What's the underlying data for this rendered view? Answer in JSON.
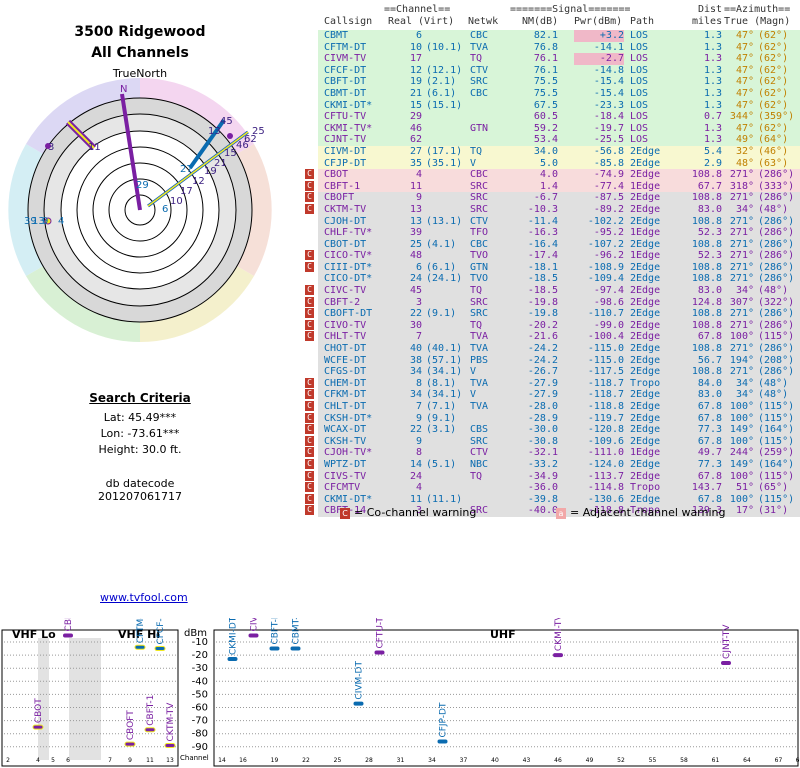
{
  "site": {
    "title_line1": "3500 Ridgewood",
    "title_line2": "All Channels",
    "true_north": "TrueNorth",
    "search_header": "Search Criteria",
    "lat": "Lat: 45.49***",
    "lon": "Lon: -73.61***",
    "height": "Height: 30.0 ft.",
    "db_label": "db datecode",
    "db_value": "201207061717",
    "link": "www.tvfool.com"
  },
  "table_headers": {
    "channel_group": "==Channel==",
    "signal_group": "=======Signal=======",
    "dist_top": "Dist",
    "azimuth_group": "==Azimuth==",
    "callsign": "Callsign",
    "real": "Real",
    "virt": "(Virt)",
    "netwk": "Netwk",
    "nm": "NM(dB)",
    "pwr": "Pwr(dBm)",
    "path": "Path",
    "miles": "miles",
    "true_magn": "True (Magn)"
  },
  "legend": {
    "co_mark": "C",
    "co_text": "= Co-channel warning",
    "adj_mark": "a",
    "adj_text": "= Adjacent channel warning"
  },
  "colors": {
    "green": "#d8f5d8",
    "yellow": "#f8f8d0",
    "red": "#f8dcdc",
    "gray": "#e0e0e0",
    "blue": "#0a6bb0",
    "purple": "#7a1fa2",
    "magenta_pwr": "#f0b8c8"
  },
  "stations": [
    {
      "call": "CBMT",
      "real": "6",
      "virt": "",
      "net": "CBC",
      "nm": "82.1",
      "pwr": "+3.2",
      "path": "LOS",
      "dist": "1.3",
      "true": "47°",
      "mag": "(62°)",
      "band": "green",
      "color": "blue",
      "warn": "",
      "hl": true
    },
    {
      "call": "CFTM-DT",
      "real": "10",
      "virt": "(10.1)",
      "net": "TVA",
      "nm": "76.8",
      "pwr": "-14.1",
      "path": "LOS",
      "dist": "1.3",
      "true": "47°",
      "mag": "(62°)",
      "band": "green",
      "color": "blue",
      "warn": ""
    },
    {
      "call": "CIVM-TV",
      "real": "17",
      "virt": "",
      "net": "TQ",
      "nm": "76.1",
      "pwr": "-2.7",
      "path": "LOS",
      "dist": "1.3",
      "true": "47°",
      "mag": "(62°)",
      "band": "green",
      "color": "purple",
      "warn": "",
      "hl": true
    },
    {
      "call": "CFCF-DT",
      "real": "12",
      "virt": "(12.1)",
      "net": "CTV",
      "nm": "76.1",
      "pwr": "-14.8",
      "path": "LOS",
      "dist": "1.3",
      "true": "47°",
      "mag": "(62°)",
      "band": "green",
      "color": "blue",
      "warn": ""
    },
    {
      "call": "CBFT-DT",
      "real": "19",
      "virt": "(2.1)",
      "net": "SRC",
      "nm": "75.5",
      "pwr": "-15.4",
      "path": "LOS",
      "dist": "1.3",
      "true": "47°",
      "mag": "(62°)",
      "band": "green",
      "color": "blue",
      "warn": ""
    },
    {
      "call": "CBMT-DT",
      "real": "21",
      "virt": "(6.1)",
      "net": "CBC",
      "nm": "75.5",
      "pwr": "-15.4",
      "path": "LOS",
      "dist": "1.3",
      "true": "47°",
      "mag": "(62°)",
      "band": "green",
      "color": "blue",
      "warn": ""
    },
    {
      "call": "CKMI-DT*",
      "real": "15",
      "virt": "(15.1)",
      "net": "",
      "nm": "67.5",
      "pwr": "-23.3",
      "path": "LOS",
      "dist": "1.3",
      "true": "47°",
      "mag": "(62°)",
      "band": "green",
      "color": "blue",
      "warn": ""
    },
    {
      "call": "CFTU-TV",
      "real": "29",
      "virt": "",
      "net": "",
      "nm": "60.5",
      "pwr": "-18.4",
      "path": "LOS",
      "dist": "0.7",
      "true": "344°",
      "mag": "(359°)",
      "band": "green",
      "color": "purple",
      "warn": ""
    },
    {
      "call": "CKMI-TV*",
      "real": "46",
      "virt": "",
      "net": "GTN",
      "nm": "59.2",
      "pwr": "-19.7",
      "path": "LOS",
      "dist": "1.3",
      "true": "47°",
      "mag": "(62°)",
      "band": "green",
      "color": "purple",
      "warn": ""
    },
    {
      "call": "CJNT-TV",
      "real": "62",
      "virt": "",
      "net": "",
      "nm": "53.4",
      "pwr": "-25.5",
      "path": "LOS",
      "dist": "1.3",
      "true": "49°",
      "mag": "(64°)",
      "band": "green",
      "color": "purple",
      "warn": ""
    },
    {
      "call": "CIVM-DT",
      "real": "27",
      "virt": "(17.1)",
      "net": "TQ",
      "nm": "34.0",
      "pwr": "-56.8",
      "path": "2Edge",
      "dist": "5.4",
      "true": "32°",
      "mag": "(46°)",
      "band": "yellow",
      "color": "blue",
      "warn": ""
    },
    {
      "call": "CFJP-DT",
      "real": "35",
      "virt": "(35.1)",
      "net": "V",
      "nm": "5.0",
      "pwr": "-85.8",
      "path": "2Edge",
      "dist": "2.9",
      "true": "48°",
      "mag": "(63°)",
      "band": "yellow",
      "color": "blue",
      "warn": ""
    },
    {
      "call": "CBOT",
      "real": "4",
      "virt": "",
      "net": "CBC",
      "nm": "4.0",
      "pwr": "-74.9",
      "path": "2Edge",
      "dist": "108.8",
      "true": "271°",
      "mag": "(286°)",
      "band": "red",
      "color": "purple",
      "warn": "C"
    },
    {
      "call": "CBFT-1",
      "real": "11",
      "virt": "",
      "net": "SRC",
      "nm": "1.4",
      "pwr": "-77.4",
      "path": "1Edge",
      "dist": "67.7",
      "true": "318°",
      "mag": "(333°)",
      "band": "red",
      "color": "purple",
      "warn": "C"
    },
    {
      "call": "CBOFT",
      "real": "9",
      "virt": "",
      "net": "SRC",
      "nm": "-6.7",
      "pwr": "-87.5",
      "path": "2Edge",
      "dist": "108.8",
      "true": "271°",
      "mag": "(286°)",
      "band": "gray",
      "color": "purple",
      "warn": "Ca"
    },
    {
      "call": "CKTM-TV",
      "real": "13",
      "virt": "",
      "net": "SRC",
      "nm": "-10.3",
      "pwr": "-89.2",
      "path": "2Edge",
      "dist": "83.0",
      "true": "34°",
      "mag": "(48°)",
      "band": "gray",
      "color": "purple",
      "warn": "C"
    },
    {
      "call": "CJOH-DT",
      "real": "13",
      "virt": "(13.1)",
      "net": "CTV",
      "nm": "-11.4",
      "pwr": "-102.2",
      "path": "2Edge",
      "dist": "108.8",
      "true": "271°",
      "mag": "(286°)",
      "band": "gray",
      "color": "blue",
      "warn": ""
    },
    {
      "call": "CHLF-TV*",
      "real": "39",
      "virt": "",
      "net": "TFO",
      "nm": "-16.3",
      "pwr": "-95.2",
      "path": "1Edge",
      "dist": "52.3",
      "true": "271°",
      "mag": "(286°)",
      "band": "gray",
      "color": "purple",
      "warn": ""
    },
    {
      "call": "CBOT-DT",
      "real": "25",
      "virt": "(4.1)",
      "net": "CBC",
      "nm": "-16.4",
      "pwr": "-107.2",
      "path": "2Edge",
      "dist": "108.8",
      "true": "271°",
      "mag": "(286°)",
      "band": "gray",
      "color": "blue",
      "warn": ""
    },
    {
      "call": "CICO-TV*",
      "real": "48",
      "virt": "",
      "net": "TVO",
      "nm": "-17.4",
      "pwr": "-96.2",
      "path": "1Edge",
      "dist": "52.3",
      "true": "271°",
      "mag": "(286°)",
      "band": "gray",
      "color": "purple",
      "warn": "Ca"
    },
    {
      "call": "CIII-DT*",
      "real": "6",
      "virt": "(6.1)",
      "net": "GTN",
      "nm": "-18.1",
      "pwr": "-108.9",
      "path": "2Edge",
      "dist": "108.8",
      "true": "271°",
      "mag": "(286°)",
      "band": "gray",
      "color": "blue",
      "warn": "C"
    },
    {
      "call": "CICO-DT*",
      "real": "24",
      "virt": "(24.1)",
      "net": "TVO",
      "nm": "-18.5",
      "pwr": "-109.4",
      "path": "2Edge",
      "dist": "108.8",
      "true": "271°",
      "mag": "(286°)",
      "band": "gray",
      "color": "blue",
      "warn": ""
    },
    {
      "call": "CIVC-TV",
      "real": "45",
      "virt": "",
      "net": "TQ",
      "nm": "-18.5",
      "pwr": "-97.4",
      "path": "2Edge",
      "dist": "83.0",
      "true": "34°",
      "mag": "(48°)",
      "band": "gray",
      "color": "purple",
      "warn": "C"
    },
    {
      "call": "CBFT-2",
      "real": "3",
      "virt": "",
      "net": "SRC",
      "nm": "-19.8",
      "pwr": "-98.6",
      "path": "2Edge",
      "dist": "124.8",
      "true": "307°",
      "mag": "(322°)",
      "band": "gray",
      "color": "purple",
      "warn": "C"
    },
    {
      "call": "CBOFT-DT",
      "real": "22",
      "virt": "(9.1)",
      "net": "SRC",
      "nm": "-19.8",
      "pwr": "-110.7",
      "path": "2Edge",
      "dist": "108.8",
      "true": "271°",
      "mag": "(286°)",
      "band": "gray",
      "color": "blue",
      "warn": "C"
    },
    {
      "call": "CIVO-TV",
      "real": "30",
      "virt": "",
      "net": "TQ",
      "nm": "-20.2",
      "pwr": "-99.0",
      "path": "2Edge",
      "dist": "108.8",
      "true": "271°",
      "mag": "(286°)",
      "band": "gray",
      "color": "purple",
      "warn": "C"
    },
    {
      "call": "CHLT-TV",
      "real": "7",
      "virt": "",
      "net": "TVA",
      "nm": "-21.6",
      "pwr": "-100.4",
      "path": "2Edge",
      "dist": "67.8",
      "true": "100°",
      "mag": "(115°)",
      "band": "gray",
      "color": "purple",
      "warn": "C"
    },
    {
      "call": "CHOT-DT",
      "real": "40",
      "virt": "(40.1)",
      "net": "TVA",
      "nm": "-24.2",
      "pwr": "-115.0",
      "path": "2Edge",
      "dist": "108.8",
      "true": "271°",
      "mag": "(286°)",
      "band": "gray",
      "color": "blue",
      "warn": ""
    },
    {
      "call": "WCFE-DT",
      "real": "38",
      "virt": "(57.1)",
      "net": "PBS",
      "nm": "-24.2",
      "pwr": "-115.0",
      "path": "2Edge",
      "dist": "56.7",
      "true": "194°",
      "mag": "(208°)",
      "band": "gray",
      "color": "blue",
      "warn": ""
    },
    {
      "call": "CFGS-DT",
      "real": "34",
      "virt": "(34.1)",
      "net": "V",
      "nm": "-26.7",
      "pwr": "-117.5",
      "path": "2Edge",
      "dist": "108.8",
      "true": "271°",
      "mag": "(286°)",
      "band": "gray",
      "color": "blue",
      "warn": ""
    },
    {
      "call": "CHEM-DT",
      "real": "8",
      "virt": "(8.1)",
      "net": "TVA",
      "nm": "-27.9",
      "pwr": "-118.7",
      "path": "Tropo",
      "dist": "84.0",
      "true": "34°",
      "mag": "(48°)",
      "band": "gray",
      "color": "blue",
      "warn": "C"
    },
    {
      "call": "CFKM-DT",
      "real": "34",
      "virt": "(34.1)",
      "net": "V",
      "nm": "-27.9",
      "pwr": "-118.7",
      "path": "2Edge",
      "dist": "83.0",
      "true": "34°",
      "mag": "(48°)",
      "band": "gray",
      "color": "blue",
      "warn": "C"
    },
    {
      "call": "CHLT-DT",
      "real": "7",
      "virt": "(7.1)",
      "net": "TVA",
      "nm": "-28.0",
      "pwr": "-118.8",
      "path": "2Edge",
      "dist": "67.8",
      "true": "100°",
      "mag": "(115°)",
      "band": "gray",
      "color": "blue",
      "warn": "C"
    },
    {
      "call": "CKSH-DT*",
      "real": "9",
      "virt": "(9.1)",
      "net": "",
      "nm": "-28.9",
      "pwr": "-119.7",
      "path": "2Edge",
      "dist": "67.8",
      "true": "100°",
      "mag": "(115°)",
      "band": "gray",
      "color": "blue",
      "warn": "C"
    },
    {
      "call": "WCAX-DT",
      "real": "22",
      "virt": "(3.1)",
      "net": "CBS",
      "nm": "-30.0",
      "pwr": "-120.8",
      "path": "2Edge",
      "dist": "77.3",
      "true": "149°",
      "mag": "(164°)",
      "band": "gray",
      "color": "blue",
      "warn": "C"
    },
    {
      "call": "CKSH-TV",
      "real": "9",
      "virt": "",
      "net": "SRC",
      "nm": "-30.8",
      "pwr": "-109.6",
      "path": "2Edge",
      "dist": "67.8",
      "true": "100°",
      "mag": "(115°)",
      "band": "gray",
      "color": "blue",
      "warn": "C"
    },
    {
      "call": "CJOH-TV*",
      "real": "8",
      "virt": "",
      "net": "CTV",
      "nm": "-32.1",
      "pwr": "-111.0",
      "path": "1Edge",
      "dist": "49.7",
      "true": "244°",
      "mag": "(259°)",
      "band": "gray",
      "color": "purple",
      "warn": "C"
    },
    {
      "call": "WPTZ-DT",
      "real": "14",
      "virt": "(5.1)",
      "net": "NBC",
      "nm": "-33.2",
      "pwr": "-124.0",
      "path": "2Edge",
      "dist": "77.3",
      "true": "149°",
      "mag": "(164°)",
      "band": "gray",
      "color": "blue",
      "warn": "C"
    },
    {
      "call": "CIVS-TV",
      "real": "24",
      "virt": "",
      "net": "TQ",
      "nm": "-34.9",
      "pwr": "-113.7",
      "path": "2Edge",
      "dist": "67.8",
      "true": "100°",
      "mag": "(115°)",
      "band": "gray",
      "color": "purple",
      "warn": "C"
    },
    {
      "call": "CFCMTV",
      "real": "4",
      "virt": "",
      "net": "",
      "nm": "-36.0",
      "pwr": "-114.8",
      "path": "Tropo",
      "dist": "143.7",
      "true": "51°",
      "mag": "(65°)",
      "band": "gray",
      "color": "purple",
      "warn": "C"
    },
    {
      "call": "CKMI-DT*",
      "real": "11",
      "virt": "(11.1)",
      "net": "",
      "nm": "-39.8",
      "pwr": "-130.6",
      "path": "2Edge",
      "dist": "67.8",
      "true": "100°",
      "mag": "(115°)",
      "band": "gray",
      "color": "blue",
      "warn": "C"
    },
    {
      "call": "CBFT-14",
      "real": "3",
      "virt": "",
      "net": "SRC",
      "nm": "-40.0",
      "pwr": "-118.8",
      "path": "Tropo",
      "dist": "139.3",
      "true": "17°",
      "mag": "(31°)",
      "band": "gray",
      "color": "purple",
      "warn": "C"
    }
  ],
  "polar_labels": [
    "N",
    "3",
    "11",
    "45",
    "13",
    "25",
    "62",
    "46",
    "15",
    "21",
    "19",
    "12",
    "17",
    "10",
    "6",
    "27",
    "29",
    "39",
    "13",
    "9",
    "4"
  ],
  "spectrum": {
    "vhf_lo": "VHF Lo",
    "vhf_hi": "VHF Hi",
    "uhf": "UHF",
    "unit": "dBm",
    "channel_label": "Channel",
    "y_ticks": [
      "-10",
      "-20",
      "-30",
      "-40",
      "-50",
      "-60",
      "-70",
      "-80",
      "-90"
    ],
    "x_ticks": [
      "2",
      "4",
      "5",
      "6",
      "7",
      "9",
      "11",
      "13",
      "14",
      "16",
      "19",
      "22",
      "25",
      "28",
      "31",
      "34",
      "37",
      "40",
      "43",
      "46",
      "49",
      "52",
      "55",
      "58",
      "61",
      "64",
      "67",
      "69"
    ],
    "markers": [
      {
        "label": "CBOT",
        "ch": 4,
        "dbm": -75,
        "color": "purple"
      },
      {
        "label": "CBMT",
        "ch": 6,
        "dbm": 3,
        "color": "purple"
      },
      {
        "label": "CBOFT",
        "ch": 9,
        "dbm": -88,
        "color": "purple"
      },
      {
        "label": "CFTM-DT",
        "ch": 10,
        "dbm": -14,
        "color": "blue"
      },
      {
        "label": "CBFT-1",
        "ch": 11,
        "dbm": -77,
        "color": "purple"
      },
      {
        "label": "CFCF-DT",
        "ch": 12,
        "dbm": -15,
        "color": "blue"
      },
      {
        "label": "CKTM-TV",
        "ch": 13,
        "dbm": -89,
        "color": "purple"
      },
      {
        "label": "CKMI-DT-1",
        "ch": 15,
        "dbm": -23,
        "color": "blue"
      },
      {
        "label": "CIVM-TV",
        "ch": 17,
        "dbm": -3,
        "color": "purple"
      },
      {
        "label": "CBFT-DT",
        "ch": 19,
        "dbm": -15,
        "color": "blue"
      },
      {
        "label": "CBMT-DT",
        "ch": 21,
        "dbm": -15,
        "color": "blue"
      },
      {
        "label": "CIVM-DT",
        "ch": 27,
        "dbm": -57,
        "color": "blue"
      },
      {
        "label": "CFTU-TV",
        "ch": 29,
        "dbm": -18,
        "color": "purple"
      },
      {
        "label": "CFJP-DT",
        "ch": 35,
        "dbm": -86,
        "color": "blue"
      },
      {
        "label": "CKMI-TV-1",
        "ch": 46,
        "dbm": -20,
        "color": "purple"
      },
      {
        "label": "CJNT-TV",
        "ch": 62,
        "dbm": -26,
        "color": "purple"
      }
    ]
  }
}
